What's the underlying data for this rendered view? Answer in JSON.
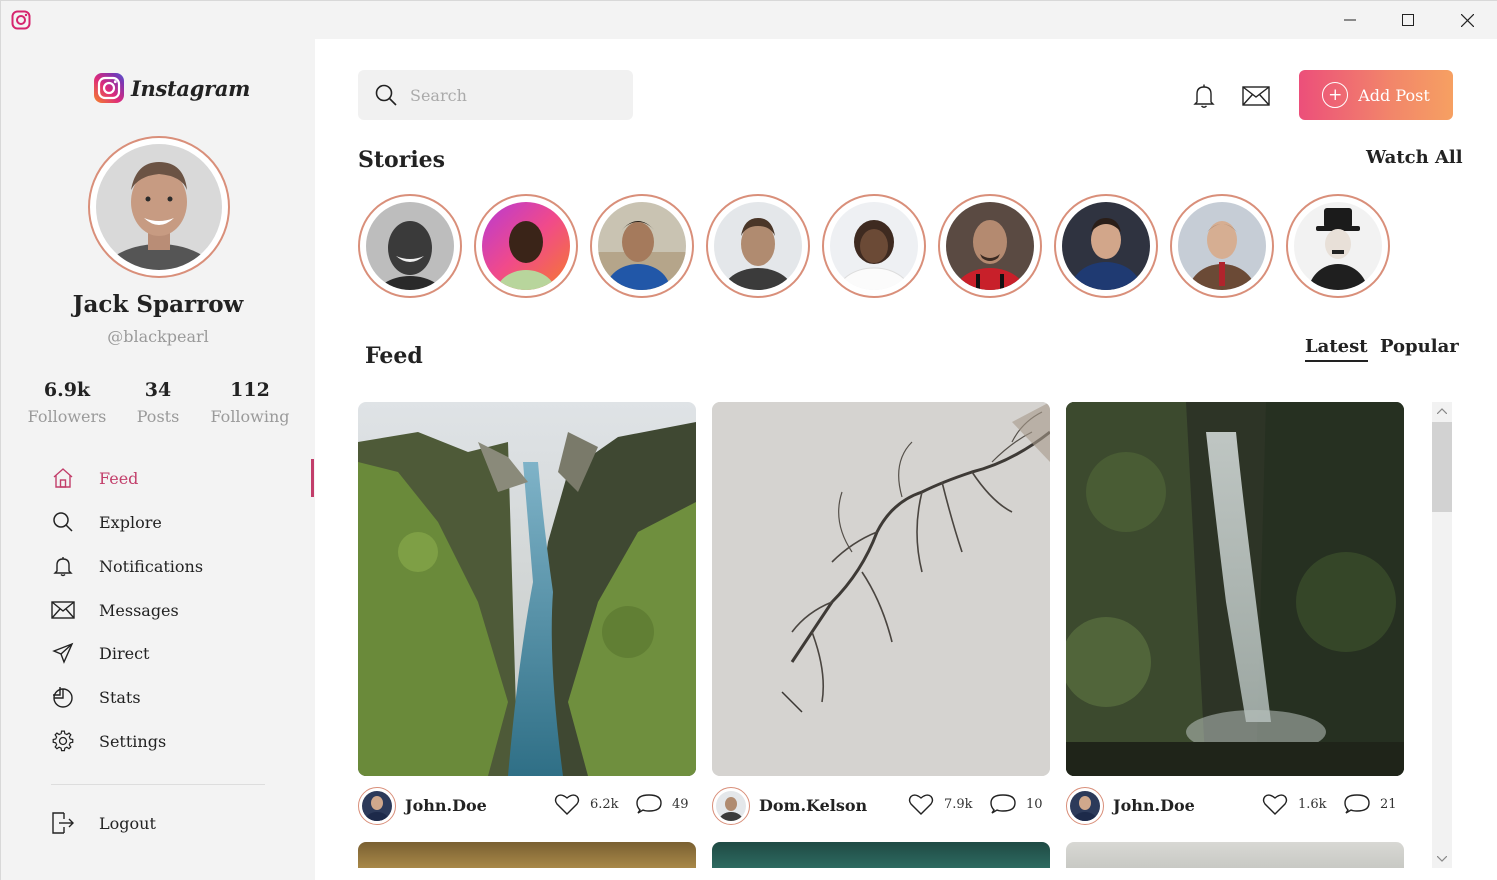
{
  "window": {
    "controls": [
      "minimize",
      "maximize",
      "close"
    ]
  },
  "app": {
    "logo_text": "Instagram",
    "brand_gradient": [
      "#f58529",
      "#dd2a7b",
      "#8134af",
      "#515bd4"
    ],
    "accent": "#c23e6a"
  },
  "profile": {
    "name": "Jack Sparrow",
    "handle": "@blackpearl"
  },
  "stats": [
    {
      "value": "6.9k",
      "label": "Followers"
    },
    {
      "value": "34",
      "label": "Posts"
    },
    {
      "value": "112",
      "label": "Following"
    }
  ],
  "nav": [
    {
      "label": "Feed",
      "icon": "home-icon",
      "active": true
    },
    {
      "label": "Explore",
      "icon": "search-icon"
    },
    {
      "label": "Notifications",
      "icon": "bell-icon"
    },
    {
      "label": "Messages",
      "icon": "mail-icon"
    },
    {
      "label": "Direct",
      "icon": "send-icon"
    },
    {
      "label": "Stats",
      "icon": "pie-chart-icon"
    },
    {
      "label": "Settings",
      "icon": "gear-icon"
    }
  ],
  "logout": {
    "label": "Logout",
    "icon": "logout-icon"
  },
  "header": {
    "search_placeholder": "Search",
    "add_post_label": "Add Post",
    "icons": [
      "bell-icon",
      "mail-icon"
    ]
  },
  "stories": {
    "title": "Stories",
    "watch_all": "Watch All",
    "count": 9
  },
  "feed": {
    "title": "Feed",
    "tabs": [
      {
        "label": "Latest",
        "active": true
      },
      {
        "label": "Popular",
        "active": false
      }
    ],
    "posts": [
      {
        "user": "John.Doe",
        "likes": "6.2k",
        "comments": "49"
      },
      {
        "user": "Dom.Kelson",
        "likes": "7.9k",
        "comments": "10"
      },
      {
        "user": "John.Doe",
        "likes": "1.6k",
        "comments": "21"
      }
    ]
  }
}
